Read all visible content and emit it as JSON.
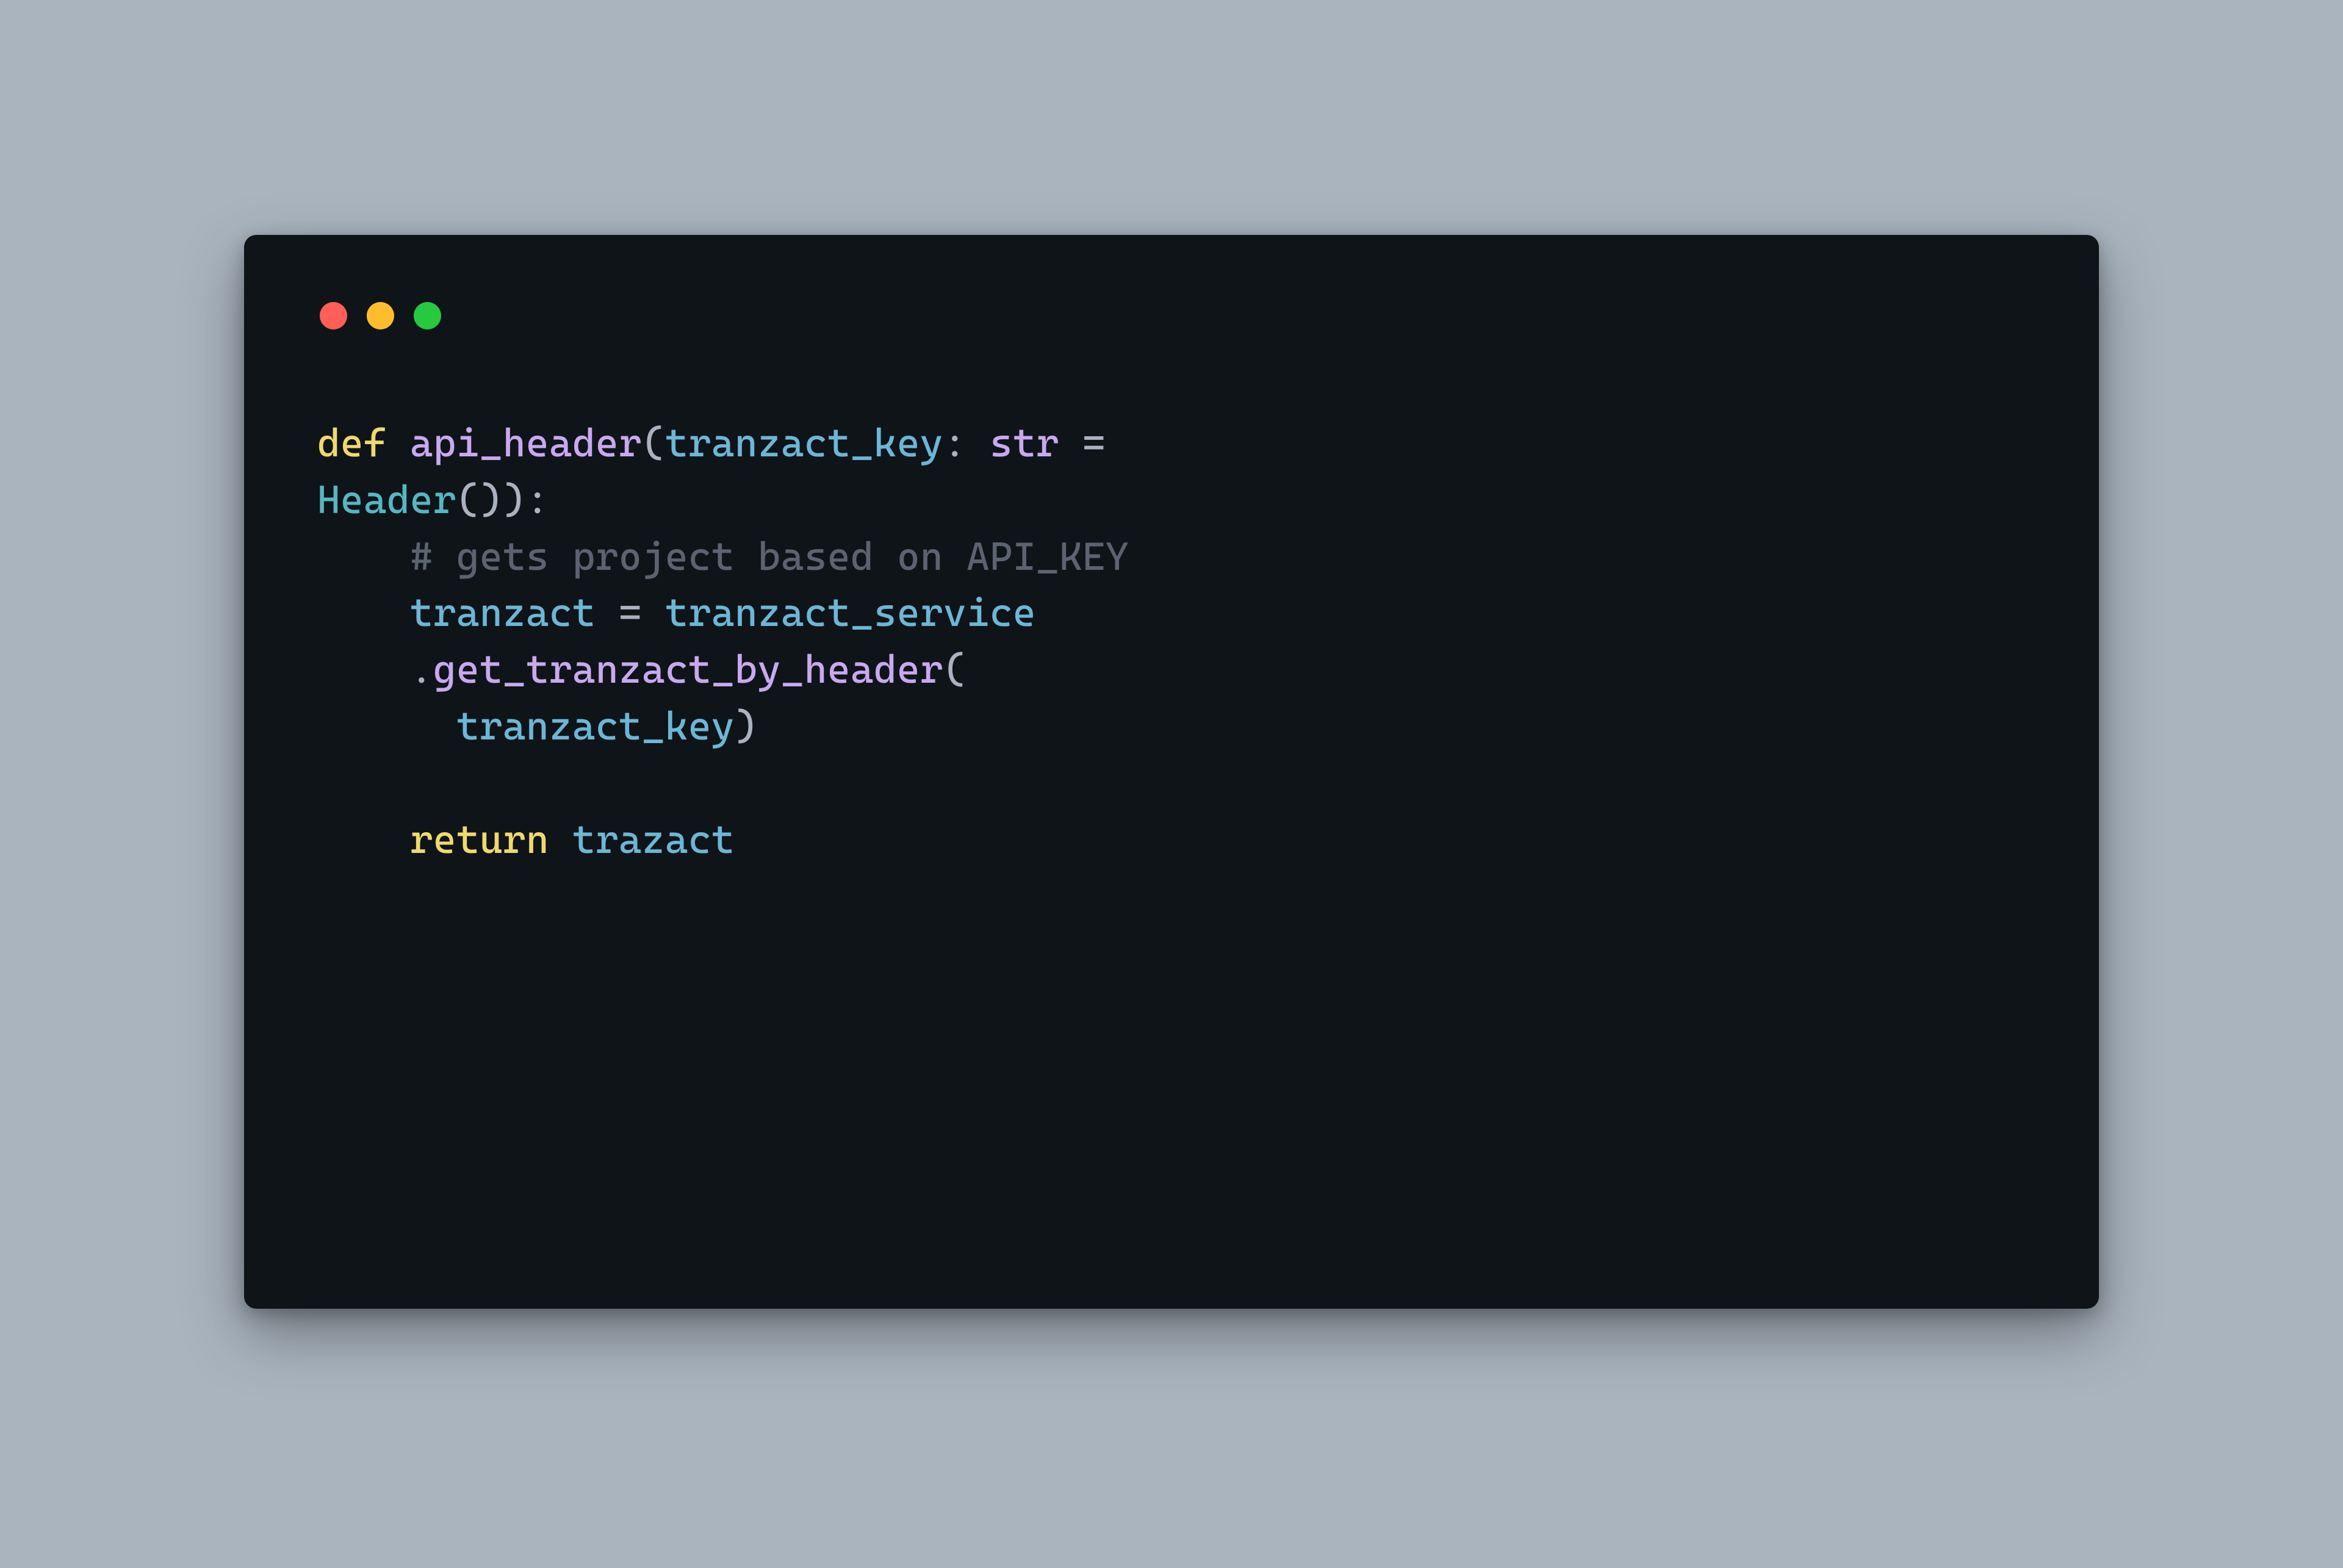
{
  "code": {
    "l1_def": "def",
    "l1_space": " ",
    "l1_fname": "api_header",
    "l1_paren_open": "(",
    "l1_param": "tranzact_key",
    "l1_colon_sp": ": ",
    "l1_type": "str",
    "l1_eq": " = ",
    "l2_header": "Header",
    "l2_call": "()):",
    "l3_indent": "    ",
    "l3_comment": "# gets project based on API_KEY",
    "l4_indent": "    ",
    "l4_var": "tranzact",
    "l4_eq": " = ",
    "l4_service": "tranzact_service",
    "l5_indent": "    ",
    "l5_dot": ".",
    "l5_method": "get_tranzact_by_header",
    "l5_paren": "(",
    "l6_indent": "      ",
    "l6_arg": "tranzact_key",
    "l6_close": ")",
    "l7_blank": "",
    "l8_indent": "    ",
    "l8_return": "return",
    "l8_space": " ",
    "l8_val": "trazact"
  }
}
